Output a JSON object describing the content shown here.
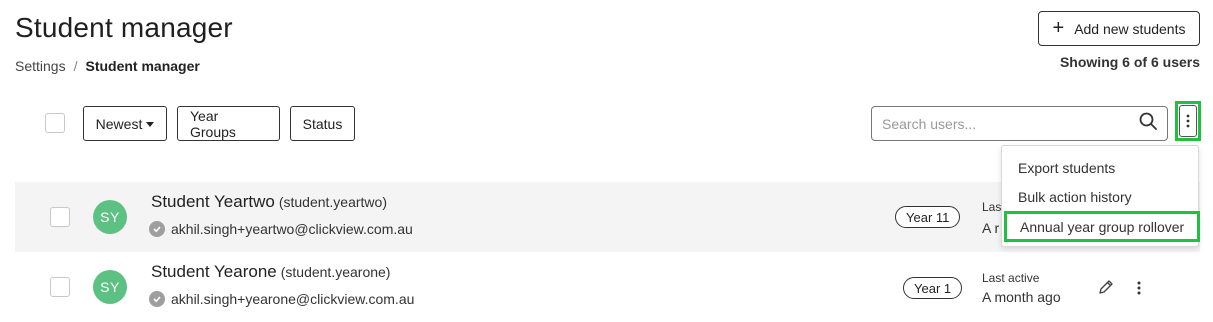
{
  "header": {
    "title": "Student manager",
    "add_button_icon": "plus-icon",
    "add_button_label": "Add new students",
    "showing_text": "Showing 6 of 6 users"
  },
  "breadcrumb": {
    "items": [
      "Settings",
      "Student manager"
    ],
    "separator": "/"
  },
  "toolbar": {
    "sort_label": "Newest",
    "year_groups_label": "Year Groups",
    "status_label": "Status",
    "search_placeholder": "Search users...",
    "search_value": ""
  },
  "menu": {
    "items": [
      "Export students",
      "Bulk action history",
      "Annual year group rollover"
    ],
    "highlight_color": "#22c040"
  },
  "students": [
    {
      "initials": "SY",
      "name": "Student Yeartwo",
      "username": "(student.yeartwo)",
      "email": "akhil.singh+yeartwo@clickview.com.au",
      "year": "Year 11",
      "last_active_label": "Last active",
      "last_active_label_visible": "Last",
      "last_active_value_visible": "A r"
    },
    {
      "initials": "SY",
      "name": "Student Yearone",
      "username": "(student.yearone)",
      "email": "akhil.singh+yearone@clickview.com.au",
      "year": "Year 1",
      "last_active_label": "Last active",
      "last_active_value": "A month ago"
    }
  ],
  "colors": {
    "avatar": "#5ec184",
    "shaded_row": "#f4f4f4",
    "verified_badge": "#9e9e9e"
  }
}
